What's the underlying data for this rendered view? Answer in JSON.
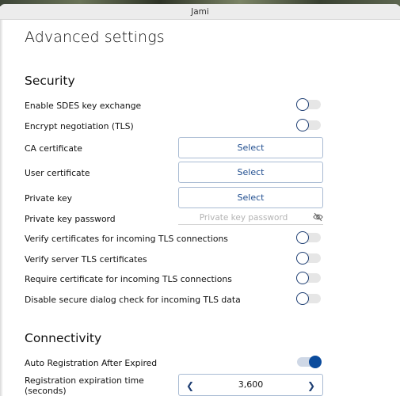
{
  "window": {
    "title": "Jami"
  },
  "page": {
    "title": "Advanced settings"
  },
  "security": {
    "title": "Security",
    "enable_sdes": {
      "label": "Enable SDES key exchange",
      "on": false
    },
    "encrypt_negotiation": {
      "label": "Encrypt negotiation (TLS)",
      "on": false
    },
    "ca_certificate": {
      "label": "CA certificate",
      "button": "Select"
    },
    "user_certificate": {
      "label": "User certificate",
      "button": "Select"
    },
    "private_key": {
      "label": "Private key",
      "button": "Select"
    },
    "private_key_password": {
      "label": "Private key password",
      "value": "",
      "placeholder": "Private key password",
      "icon": "eye-slash-icon"
    },
    "verify_incoming": {
      "label": "Verify certificates for incoming TLS connections",
      "on": false
    },
    "verify_server": {
      "label": "Verify server TLS certificates",
      "on": false
    },
    "require_certificate": {
      "label": "Require certificate for incoming TLS connections",
      "on": false
    },
    "disable_secure_dialog": {
      "label": "Disable secure dialog check for incoming TLS data",
      "on": false
    }
  },
  "connectivity": {
    "title": "Connectivity",
    "auto_registration": {
      "label": "Auto Registration After Expired",
      "on": true
    },
    "registration_expiration": {
      "label_line1": "Registration expiration time",
      "label_line2": "(seconds)",
      "value": "3,600"
    }
  },
  "colors": {
    "accent": "#0b4b9c",
    "button_text": "#1f4d8f",
    "button_border": "#a9bbd3"
  }
}
